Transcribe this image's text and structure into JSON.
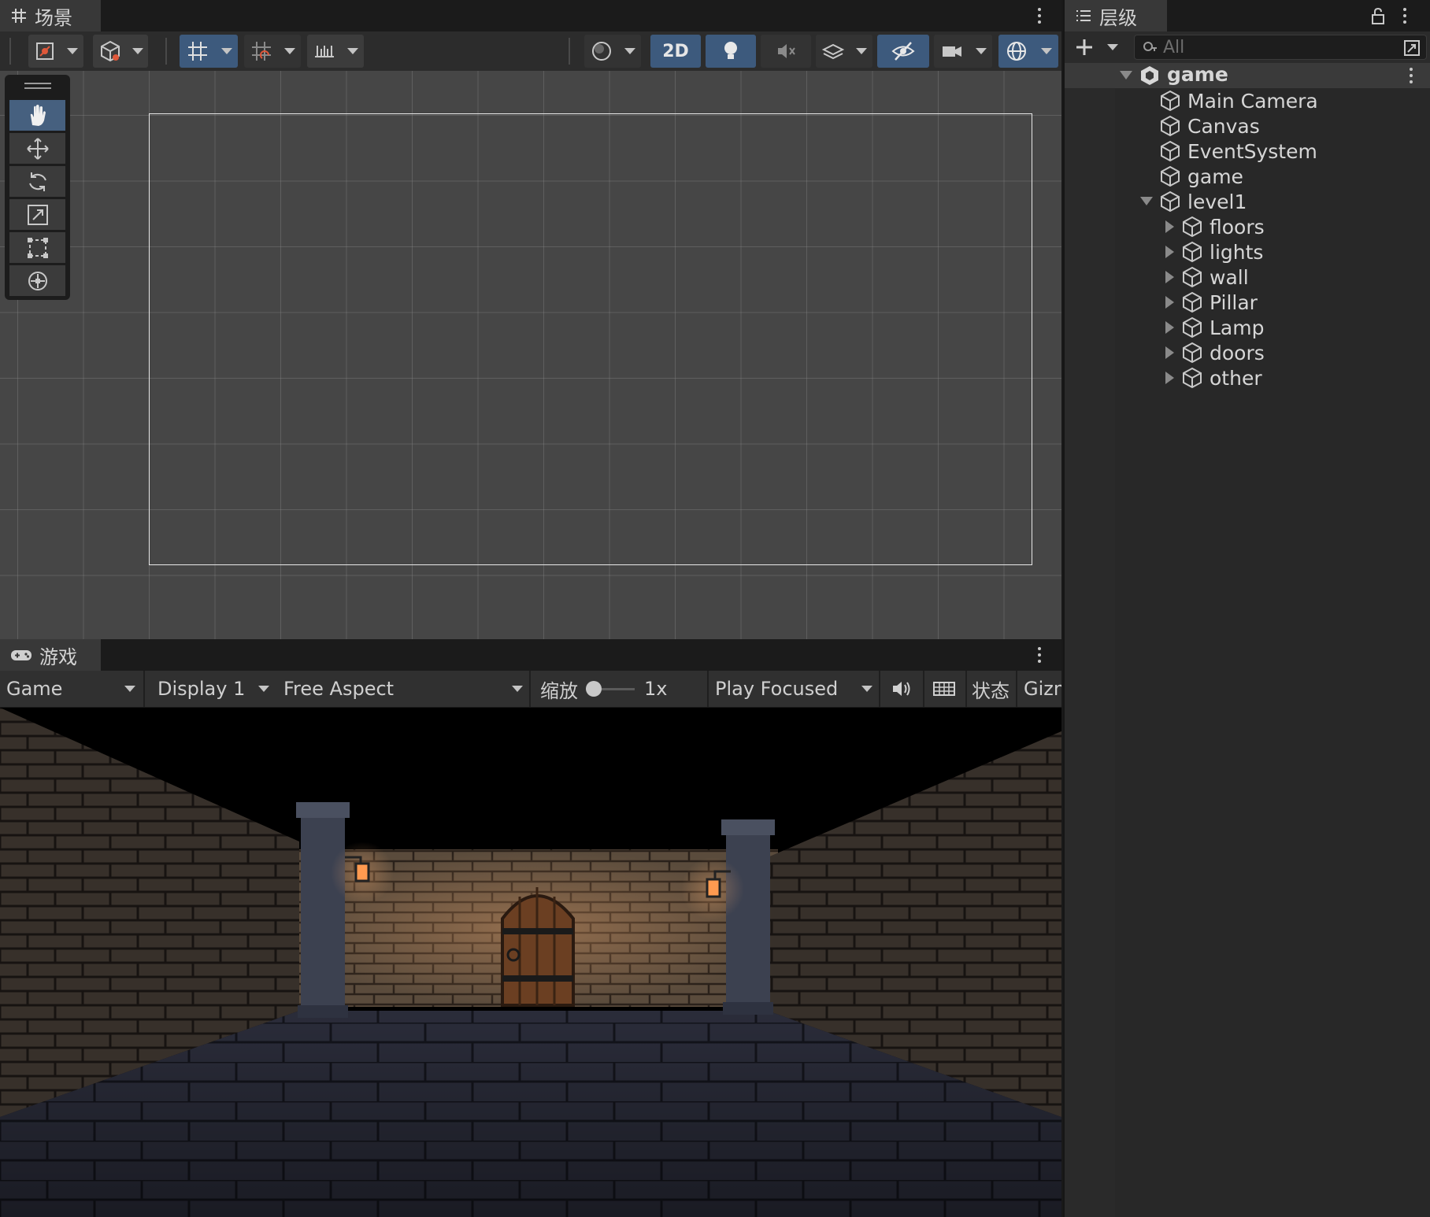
{
  "scene_panel": {
    "tab_title": "场景",
    "toolbar": {
      "mode_2d_label": "2D"
    },
    "tools": [
      "hand-tool",
      "move-tool",
      "rotate-tool",
      "scale-tool",
      "rect-tool",
      "transform-tool"
    ]
  },
  "game_panel": {
    "tab_title": "游戏",
    "view_select": "Game",
    "display_select": "Display 1",
    "aspect_select": "Free Aspect",
    "scale_label": "缩放",
    "scale_value": "1x",
    "play_mode_select": "Play Focused",
    "stats_label": "状态",
    "gizmos_label": "Gizm"
  },
  "hierarchy": {
    "tab_title": "层级",
    "search_placeholder": "All",
    "scene_name": "game",
    "items": [
      {
        "label": "Main Camera"
      },
      {
        "label": "Canvas"
      },
      {
        "label": "EventSystem"
      },
      {
        "label": "game"
      },
      {
        "label": "level1"
      },
      {
        "label": "floors"
      },
      {
        "label": "lights"
      },
      {
        "label": "wall"
      },
      {
        "label": "Pillar"
      },
      {
        "label": "Lamp"
      },
      {
        "label": "doors"
      },
      {
        "label": "other"
      }
    ]
  },
  "colors": {
    "active_button": "#3d5a7d",
    "panel_bg": "#282828",
    "scene_bg": "#464646"
  }
}
